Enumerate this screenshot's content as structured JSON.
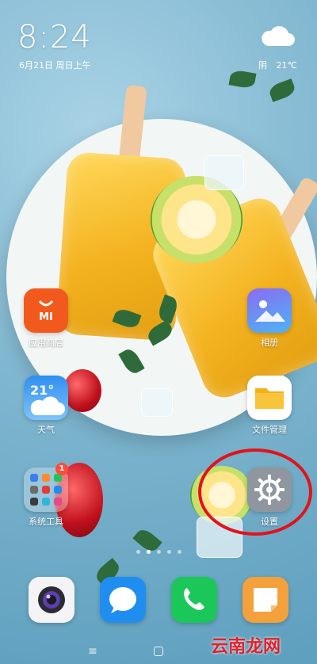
{
  "status": {
    "time": "8:24",
    "date": "6月21日 周日上午",
    "weather_condition": "阴",
    "weather_temp": "21℃"
  },
  "apps": {
    "app_store": {
      "label": "应用商店",
      "icon_text": "MI"
    },
    "gallery": {
      "label": "相册"
    },
    "weather": {
      "label": "天气",
      "icon_temp": "21°"
    },
    "file_manager": {
      "label": "文件管理"
    },
    "system_tools": {
      "label": "系统工具",
      "badge": "1"
    },
    "settings": {
      "label": "设置"
    }
  },
  "dock": [
    "camera",
    "messages-bubble",
    "phone",
    "notes"
  ],
  "pagination": {
    "total": 5,
    "active": 1
  },
  "watermark": "云南龙网",
  "colors": {
    "accent_red": "#e3121a",
    "app_store": "#f25a1d",
    "phone": "#1cc759",
    "notes": "#f5a13b",
    "messages": "#1f8ef0",
    "files": "#f3b11c"
  }
}
